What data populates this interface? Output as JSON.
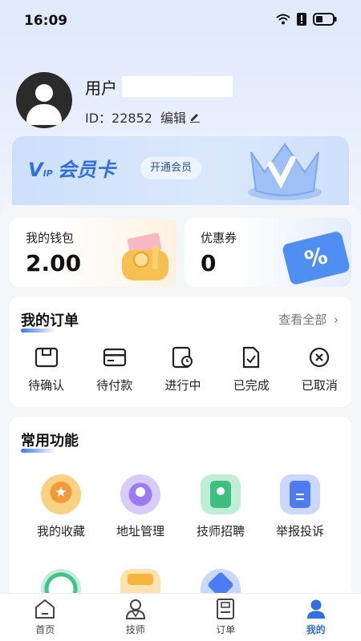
{
  "status_bar": {
    "time": "16:09"
  },
  "profile": {
    "name": "用户",
    "id_text": "ID：22852",
    "edit_label": "编辑"
  },
  "vip": {
    "logo_mark": "V",
    "logo_sub": "IP",
    "title": "会员卡",
    "button": "开通会员"
  },
  "wallet": {
    "title": "我的钱包",
    "value": "2.00"
  },
  "coupon": {
    "title": "优惠券",
    "value": "0",
    "icon_text": "%"
  },
  "orders": {
    "title": "我的订单",
    "view_all": "查看全部",
    "items": [
      {
        "label": "待确认",
        "icon": "pending-confirm-icon"
      },
      {
        "label": "待付款",
        "icon": "payment-card-icon"
      },
      {
        "label": "进行中",
        "icon": "in-progress-icon"
      },
      {
        "label": "已完成",
        "icon": "completed-doc-icon"
      },
      {
        "label": "已取消",
        "icon": "cancel-circle-icon"
      }
    ]
  },
  "functions": {
    "title": "常用功能",
    "items": [
      {
        "label": "我的收藏",
        "icon": "star-favorite-icon",
        "color": "#f7a23e"
      },
      {
        "label": "地址管理",
        "icon": "location-pin-icon",
        "color": "#9b7ef5"
      },
      {
        "label": "技师招聘",
        "icon": "badge-icon",
        "color": "#3fbf7f"
      },
      {
        "label": "举报投诉",
        "icon": "report-icon",
        "color": "#4d7cf2"
      }
    ],
    "row2": [
      {
        "icon": "green-ring-icon",
        "color": "#43c487"
      },
      {
        "icon": "gift-icon",
        "color": "#f7b53e"
      },
      {
        "icon": "house-icon",
        "color": "#4d7cf2"
      }
    ]
  },
  "tabbar": {
    "items": [
      {
        "label": "首页",
        "icon": "home-icon"
      },
      {
        "label": "技师",
        "icon": "technician-icon"
      },
      {
        "label": "订单",
        "icon": "order-doc-icon"
      },
      {
        "label": "我的",
        "icon": "profile-icon"
      }
    ],
    "active": "我的",
    "active_color": "#2f6fe0"
  }
}
